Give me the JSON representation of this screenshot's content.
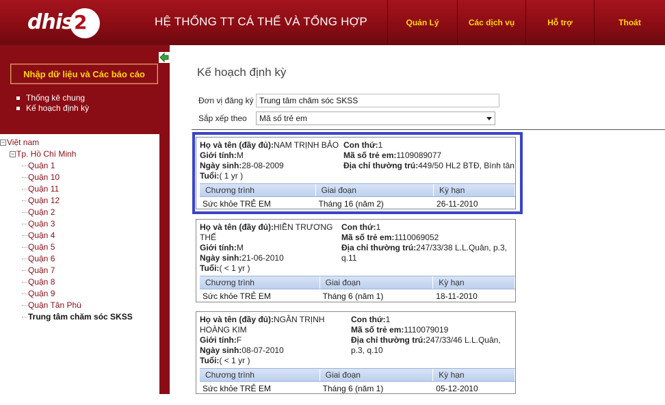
{
  "header": {
    "logo_text": "dhis",
    "logo_number": "2",
    "app_title": "HỆ THỐNG TT CÁ THỂ VÀ TỔNG HỢP",
    "nav": [
      "Quản Lý",
      "Các dịch vụ",
      "Hỗ trợ",
      "Thoát"
    ]
  },
  "sidebar": {
    "panel_button": "Nhập dữ liệu và Các báo cáo",
    "links": [
      "Thống kê chung",
      "Kế hoạch định kỳ"
    ],
    "tree": {
      "root": "Việt nam",
      "city": "Tp. Hồ Chí Minh",
      "districts": [
        "Quận 1",
        "Quận 10",
        "Quận 11",
        "Quận 12",
        "Quận 2",
        "Quận 3",
        "Quận 4",
        "Quận 5",
        "Quận 6",
        "Quận 7",
        "Quận 8",
        "Quận 9",
        "Quận Tân Phú"
      ],
      "selected": "Trung tâm chăm sóc SKSS"
    }
  },
  "main": {
    "page_title": "Kế hoạch định kỳ",
    "org_label": "Đơn vị đăng ký",
    "org_value": "Trung tâm chăm sóc SKSS",
    "sort_label": "Sắp xếp theo",
    "sort_value": "Mã số trẻ em",
    "labels": {
      "name": "Họ và tên (đầy đủ):",
      "gender": "Giới tính:",
      "dob": "Ngày sinh:",
      "age": "Tuổi:",
      "child_order": "Con thứ:",
      "child_id": "Mã số trẻ em:",
      "address": "Địa chỉ thường trú:"
    },
    "table_headers": [
      "Chương trình",
      "Giai đoạn",
      "Kỳ hạn"
    ],
    "cards": [
      {
        "name_l1": "NAM TRỊNH BẢO",
        "name_l2": "",
        "gender": "M",
        "dob": "28-08-2009",
        "age": "( 1 yr )",
        "child_order": "1",
        "child_id": "1109089077",
        "address_l1": "449/50 HL2 BTĐ, Bình tân",
        "address_l2": "",
        "program": "Sức khỏe TRẺ EM",
        "stage": "Tháng 16 (năm 2)",
        "due": "26-11-2010"
      },
      {
        "name_l1": "HIỀN TRƯƠNG",
        "name_l2": "THẾ",
        "gender": "M",
        "dob": "21-06-2010",
        "age": "( < 1 yr )",
        "child_order": "1",
        "child_id": "1110069052",
        "address_l1": "247/33/38 L.L.Quân, p.3,",
        "address_l2": "q.11",
        "program": "Sức khỏe TRẺ EM",
        "stage": "Tháng 6 (năm 1)",
        "due": "18-11-2010"
      },
      {
        "name_l1": "NGÂN TRỊNH",
        "name_l2": "HOÀNG KIM",
        "gender": "F",
        "dob": "08-07-2010",
        "age": "( < 1 yr )",
        "child_order": "1",
        "child_id": "1110079019",
        "address_l1": "247/33/46 L.L.Quân,",
        "address_l2": "p.3, q.10",
        "program": "Sức khỏe TRẺ EM",
        "stage": "Tháng 6 (năm 1)",
        "due": "05-12-2010"
      }
    ]
  }
}
